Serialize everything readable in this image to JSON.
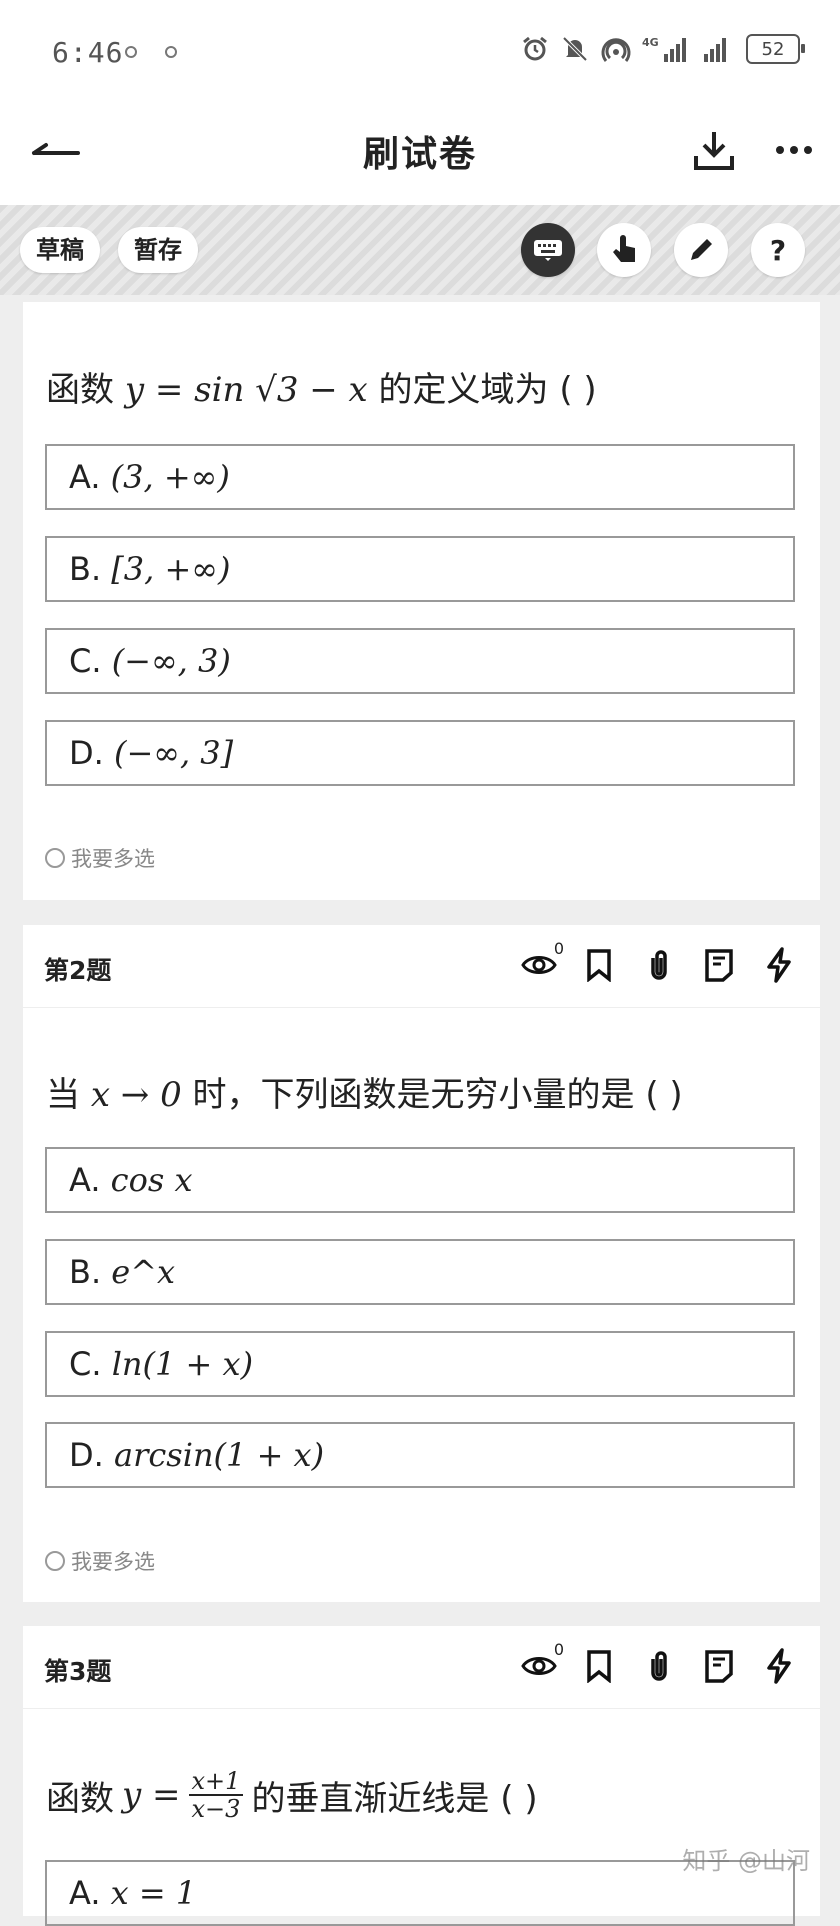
{
  "status": {
    "time": "6:46",
    "battery": "52",
    "signal": "4G"
  },
  "header": {
    "title": "刷试卷"
  },
  "toolbar": {
    "draft_label": "草稿",
    "save_label": "暂存"
  },
  "q1": {
    "text_prefix": "函数",
    "formula": "y = sin √3 − x",
    "text_suffix": "的定义域为 ( )",
    "options": [
      {
        "letter": "A.",
        "value": "(3, +∞)"
      },
      {
        "letter": "B.",
        "value": "[3, +∞)"
      },
      {
        "letter": "C.",
        "value": "(−∞, 3)"
      },
      {
        "letter": "D.",
        "value": "(−∞, 3]"
      }
    ],
    "multi_label": "我要多选"
  },
  "q2": {
    "number": "第2题",
    "view_count": "0",
    "text_prefix": "当",
    "formula": "x → 0",
    "text_suffix": "时，下列函数是无穷小量的是 ( )",
    "options": [
      {
        "letter": "A.",
        "value": "cos x"
      },
      {
        "letter": "B.",
        "value": "e^x"
      },
      {
        "letter": "C.",
        "value": "ln(1 + x)"
      },
      {
        "letter": "D.",
        "value": "arcsin(1 + x)"
      }
    ],
    "multi_label": "我要多选"
  },
  "q3": {
    "number": "第3题",
    "view_count": "0",
    "text_prefix": "函数",
    "formula_y": "y =",
    "frac_num": "x+1",
    "frac_den": "x−3",
    "text_suffix": "的垂直渐近线是 ( )",
    "options": [
      {
        "letter": "A.",
        "value": "x = 1"
      }
    ]
  },
  "watermark": "知乎 @山河"
}
